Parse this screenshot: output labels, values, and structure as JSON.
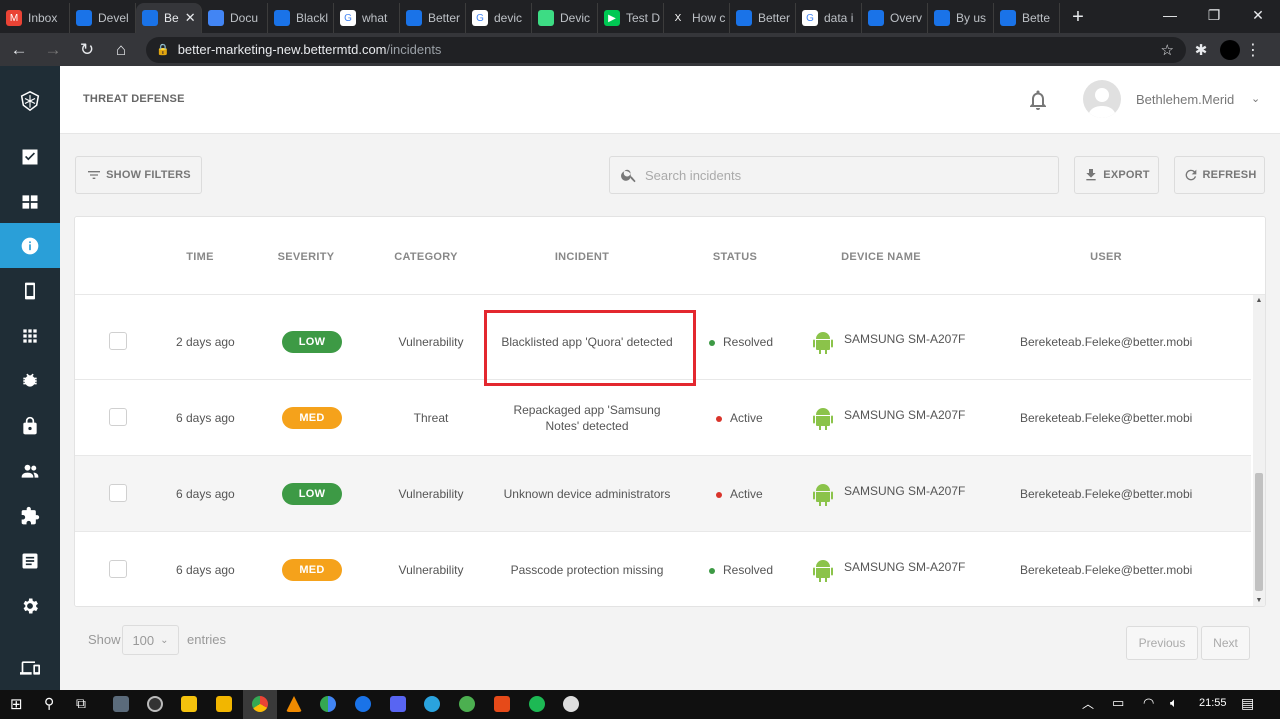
{
  "browser": {
    "tabs": [
      {
        "title": "Inbox",
        "fav": "M",
        "fav_color": "#ea4335"
      },
      {
        "title": "Devel",
        "fav": "",
        "fav_color": "#1a73e8"
      },
      {
        "title": "Be",
        "fav": "",
        "fav_color": "#1a73e8",
        "active": true
      },
      {
        "title": "Docu",
        "fav": "",
        "fav_color": "#4285f4"
      },
      {
        "title": "Blackl",
        "fav": "",
        "fav_color": "#1a73e8"
      },
      {
        "title": "what",
        "fav": "G",
        "fav_color": "#ffffff"
      },
      {
        "title": "Better",
        "fav": "",
        "fav_color": "#1a73e8"
      },
      {
        "title": "devic",
        "fav": "G",
        "fav_color": "#ffffff"
      },
      {
        "title": "Devic",
        "fav": "",
        "fav_color": "#3ddc84"
      },
      {
        "title": "Test D",
        "fav": "▶",
        "fav_color": "#00c853"
      },
      {
        "title": "How c",
        "fav": "X",
        "fav_color": "#202124"
      },
      {
        "title": "Better",
        "fav": "",
        "fav_color": "#1a73e8"
      },
      {
        "title": "data i",
        "fav": "G",
        "fav_color": "#ffffff"
      },
      {
        "title": "Overv",
        "fav": "",
        "fav_color": "#1a73e8"
      },
      {
        "title": "By us",
        "fav": "",
        "fav_color": "#1a73e8"
      },
      {
        "title": "Bette",
        "fav": "",
        "fav_color": "#1a73e8"
      }
    ],
    "url_host": "better-marketing-new.bettermtd.com",
    "url_path": "/incidents"
  },
  "header": {
    "title": "THREAT DEFENSE",
    "username": "Bethlehem.Merid"
  },
  "filters": {
    "show_filters": "SHOW FILTERS",
    "search_placeholder": "Search incidents",
    "export": "EXPORT",
    "refresh": "REFRESH"
  },
  "table": {
    "columns": [
      "TIME",
      "SEVERITY",
      "CATEGORY",
      "INCIDENT",
      "STATUS",
      "DEVICE NAME",
      "USER"
    ],
    "rows": [
      {
        "time": "2 days ago",
        "severity": "LOW",
        "category": "Vulnerability",
        "incident": "Blacklisted app 'Quora' detected",
        "status": "Resolved",
        "device": "SAMSUNG SM-A207F",
        "user": "Bereketeab.Feleke@better.mobi"
      },
      {
        "time": "6 days ago",
        "severity": "MED",
        "category": "Threat",
        "incident": "Repackaged app 'Samsung Notes' detected",
        "status": "Active",
        "device": "SAMSUNG SM-A207F",
        "user": "Bereketeab.Feleke@better.mobi"
      },
      {
        "time": "6 days ago",
        "severity": "LOW",
        "category": "Vulnerability",
        "incident": "Unknown device administrators",
        "status": "Active",
        "device": "SAMSUNG SM-A207F",
        "user": "Bereketeab.Feleke@better.mobi"
      },
      {
        "time": "6 days ago",
        "severity": "MED",
        "category": "Vulnerability",
        "incident": "Passcode protection missing",
        "status": "Resolved",
        "device": "SAMSUNG SM-A207F",
        "user": "Bereketeab.Feleke@better.mobi"
      }
    ]
  },
  "footer": {
    "show": "Show",
    "entries_value": "100",
    "entries": "entries",
    "previous": "Previous",
    "next": "Next"
  },
  "taskbar": {
    "time": "21:55"
  },
  "colors": {
    "low": "#3d9a45",
    "med": "#f5a21b",
    "resolved": "#3d9a45",
    "active": "#d9342b",
    "accent": "#2a9fd8",
    "sidebar": "#1f2d36",
    "highlight": "#e3282f",
    "android": "#8bc34a"
  }
}
